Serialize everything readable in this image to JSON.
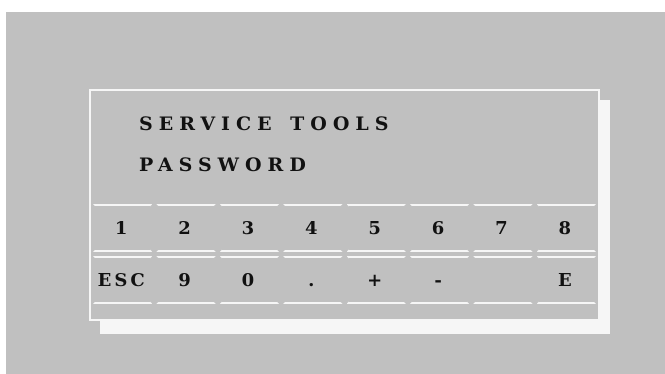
{
  "screen": {
    "title": "SERVICE TOOLS",
    "prompt": "PASSWORD"
  },
  "keypad": {
    "row1": [
      "1",
      "2",
      "3",
      "4",
      "5",
      "6",
      "7",
      "8"
    ],
    "row2": [
      "ESC",
      "9",
      "0",
      ".",
      "+",
      "-",
      "",
      "E"
    ]
  }
}
